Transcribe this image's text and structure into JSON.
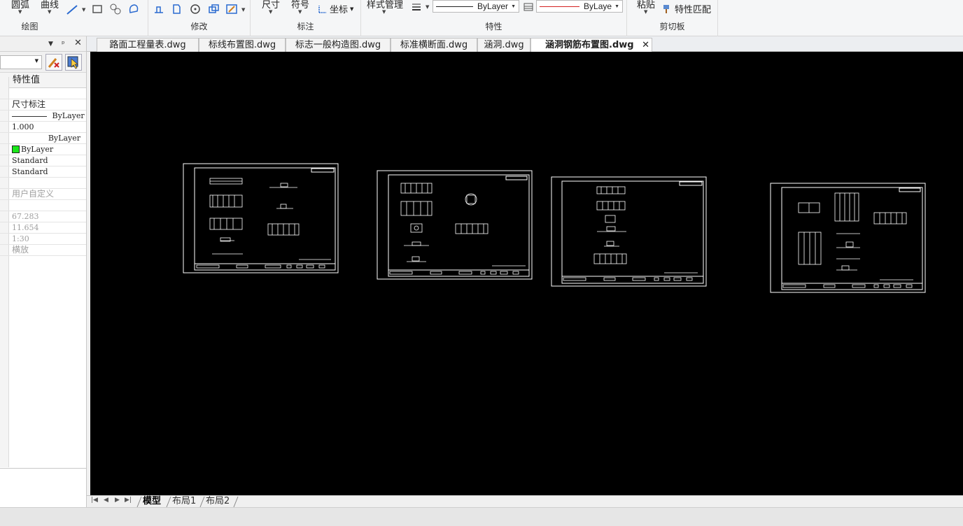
{
  "ribbon": {
    "draw_group": {
      "label": "绘图",
      "arc_label": "圆弧",
      "curve_label": "曲线"
    },
    "modify_group": {
      "label": "修改"
    },
    "annotate_group": {
      "label": "标注",
      "dimension_label": "尺寸",
      "symbol_label": "符号",
      "coordinate_label": "坐标"
    },
    "properties_group": {
      "label": "特性",
      "style_manager_label": "样式管理",
      "linetype_value": "ByLayer",
      "color_value": "ByLaye"
    },
    "clipboard_group": {
      "label": "剪切板",
      "paste_label": "粘贴",
      "match_properties_label": "特性匹配"
    }
  },
  "palette": {
    "header_label": "特性值",
    "rows": [
      {
        "text": ""
      },
      {
        "text": "尺寸标注"
      },
      {
        "text": "ByLayer"
      },
      {
        "text": "1.000"
      },
      {
        "text": "ByLayer"
      },
      {
        "text": "ByLayer"
      },
      {
        "text": "Standard"
      },
      {
        "text": "Standard"
      },
      {
        "text": ""
      },
      {
        "text": "用户自定义"
      },
      {
        "text": ""
      },
      {
        "text": "67.283"
      },
      {
        "text": "11.654"
      },
      {
        "text": "1:30"
      },
      {
        "text": "横放"
      }
    ]
  },
  "doc_tabs": [
    {
      "label": "路面工程量表.dwg"
    },
    {
      "label": "标线布置图.dwg"
    },
    {
      "label": "标志一般构造图.dwg"
    },
    {
      "label": "标准横断面.dwg"
    },
    {
      "label": "涵洞.dwg"
    },
    {
      "label": "涵洞钢筋布置图.dwg",
      "active": true
    }
  ],
  "layout_tabs": [
    {
      "label": "模型",
      "active": true
    },
    {
      "label": "布局1"
    },
    {
      "label": "布局2"
    }
  ],
  "colors": {
    "canvas_bg": "#000000",
    "drawing_lines": "#ffffff",
    "color_swatch": "#19e619",
    "color_line": "#d42020"
  }
}
